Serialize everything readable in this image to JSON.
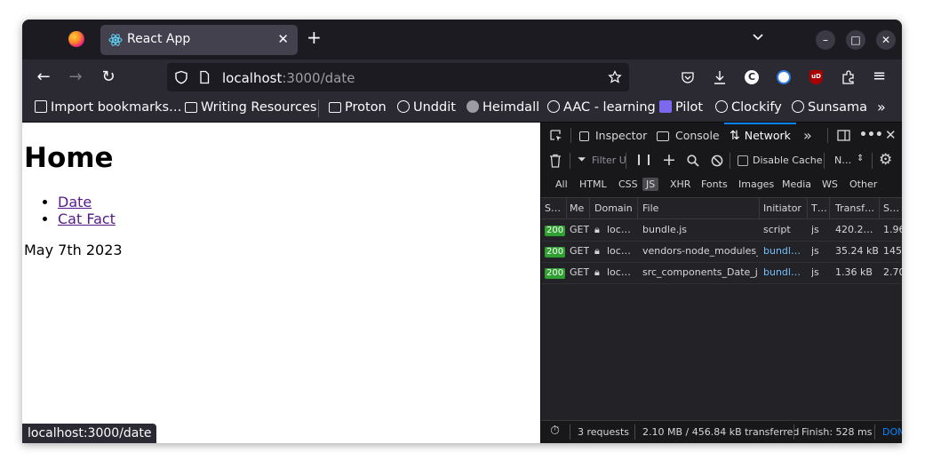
{
  "browser": {
    "tab_title": "React App",
    "url_host": "localhost",
    "url_path": ":3000/date",
    "bookmarks": [
      "Import bookmarks…",
      "Writing Resources",
      "Proton",
      "Unddit",
      "Heimdall",
      "AAC - learning",
      "Pilot",
      "Clockify",
      "Sunsama"
    ]
  },
  "page": {
    "heading": "Home",
    "links": [
      "Date",
      "Cat Fact"
    ],
    "date_text": "May 7th 2023",
    "status_url": "localhost:3000/date"
  },
  "devtools": {
    "tabs": [
      "Inspector",
      "Console",
      "Network"
    ],
    "active_tab": "Network",
    "filter_placeholder": "Filter U",
    "disable_cache_label": "Disable Cache",
    "throttle_label": "N…",
    "filters": [
      "All",
      "HTML",
      "CSS",
      "JS",
      "XHR",
      "Fonts",
      "Images",
      "Media",
      "WS",
      "Other"
    ],
    "active_filter": "JS",
    "columns": [
      "S…",
      "Me",
      "Domain",
      "File",
      "Initiator",
      "T…",
      "Transf…",
      "S…"
    ],
    "rows": [
      {
        "status": "200",
        "method": "GET",
        "domain": "loc…",
        "file": "bundle.js",
        "initiator": "script",
        "type": "js",
        "transferred": "420.2…",
        "size": "1.96"
      },
      {
        "status": "200",
        "method": "GET",
        "domain": "loc…",
        "file": "vendors-node_modules_m",
        "initiator": "bundl…",
        "type": "js",
        "transferred": "35.24 kB",
        "size": "145."
      },
      {
        "status": "200",
        "method": "GET",
        "domain": "loc…",
        "file": "src_components_Date_js.c",
        "initiator": "bundl…",
        "type": "js",
        "transferred": "1.36 kB",
        "size": "2.70"
      }
    ],
    "footer": {
      "requests": "3 requests",
      "transferred": "2.10 MB / 456.84 kB transferred",
      "finish": "Finish: 528 ms",
      "dom": "DOM"
    }
  },
  "colors": {
    "chrome_dark": "#1c1b22",
    "toolbar": "#2b2a33",
    "accent": "#0a84ff",
    "link_visited": "#551a8b",
    "status_ok": "#30a030"
  }
}
